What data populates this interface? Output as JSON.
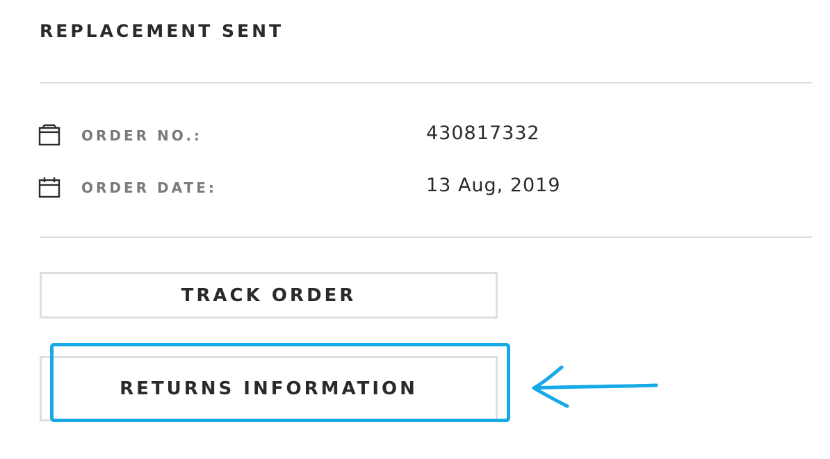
{
  "order_status": "REPLACEMENT SENT",
  "details": [
    {
      "icon": "box-icon",
      "label": "ORDER NO.:",
      "value": "430817332"
    },
    {
      "icon": "calendar-icon",
      "label": "ORDER DATE:",
      "value": "13 Aug, 2019"
    }
  ],
  "actions": {
    "track_order": "TRACK ORDER",
    "returns_information": "RETURNS INFORMATION"
  },
  "annotation": {
    "highlight_color": "#15a9e8",
    "target": "returns-information-button"
  },
  "colors": {
    "text_primary": "#2a2a2a",
    "text_label": "#7a7a7a",
    "divider": "#dcdcdc",
    "button_border": "#dedede",
    "annotation": "#15a9e8"
  }
}
